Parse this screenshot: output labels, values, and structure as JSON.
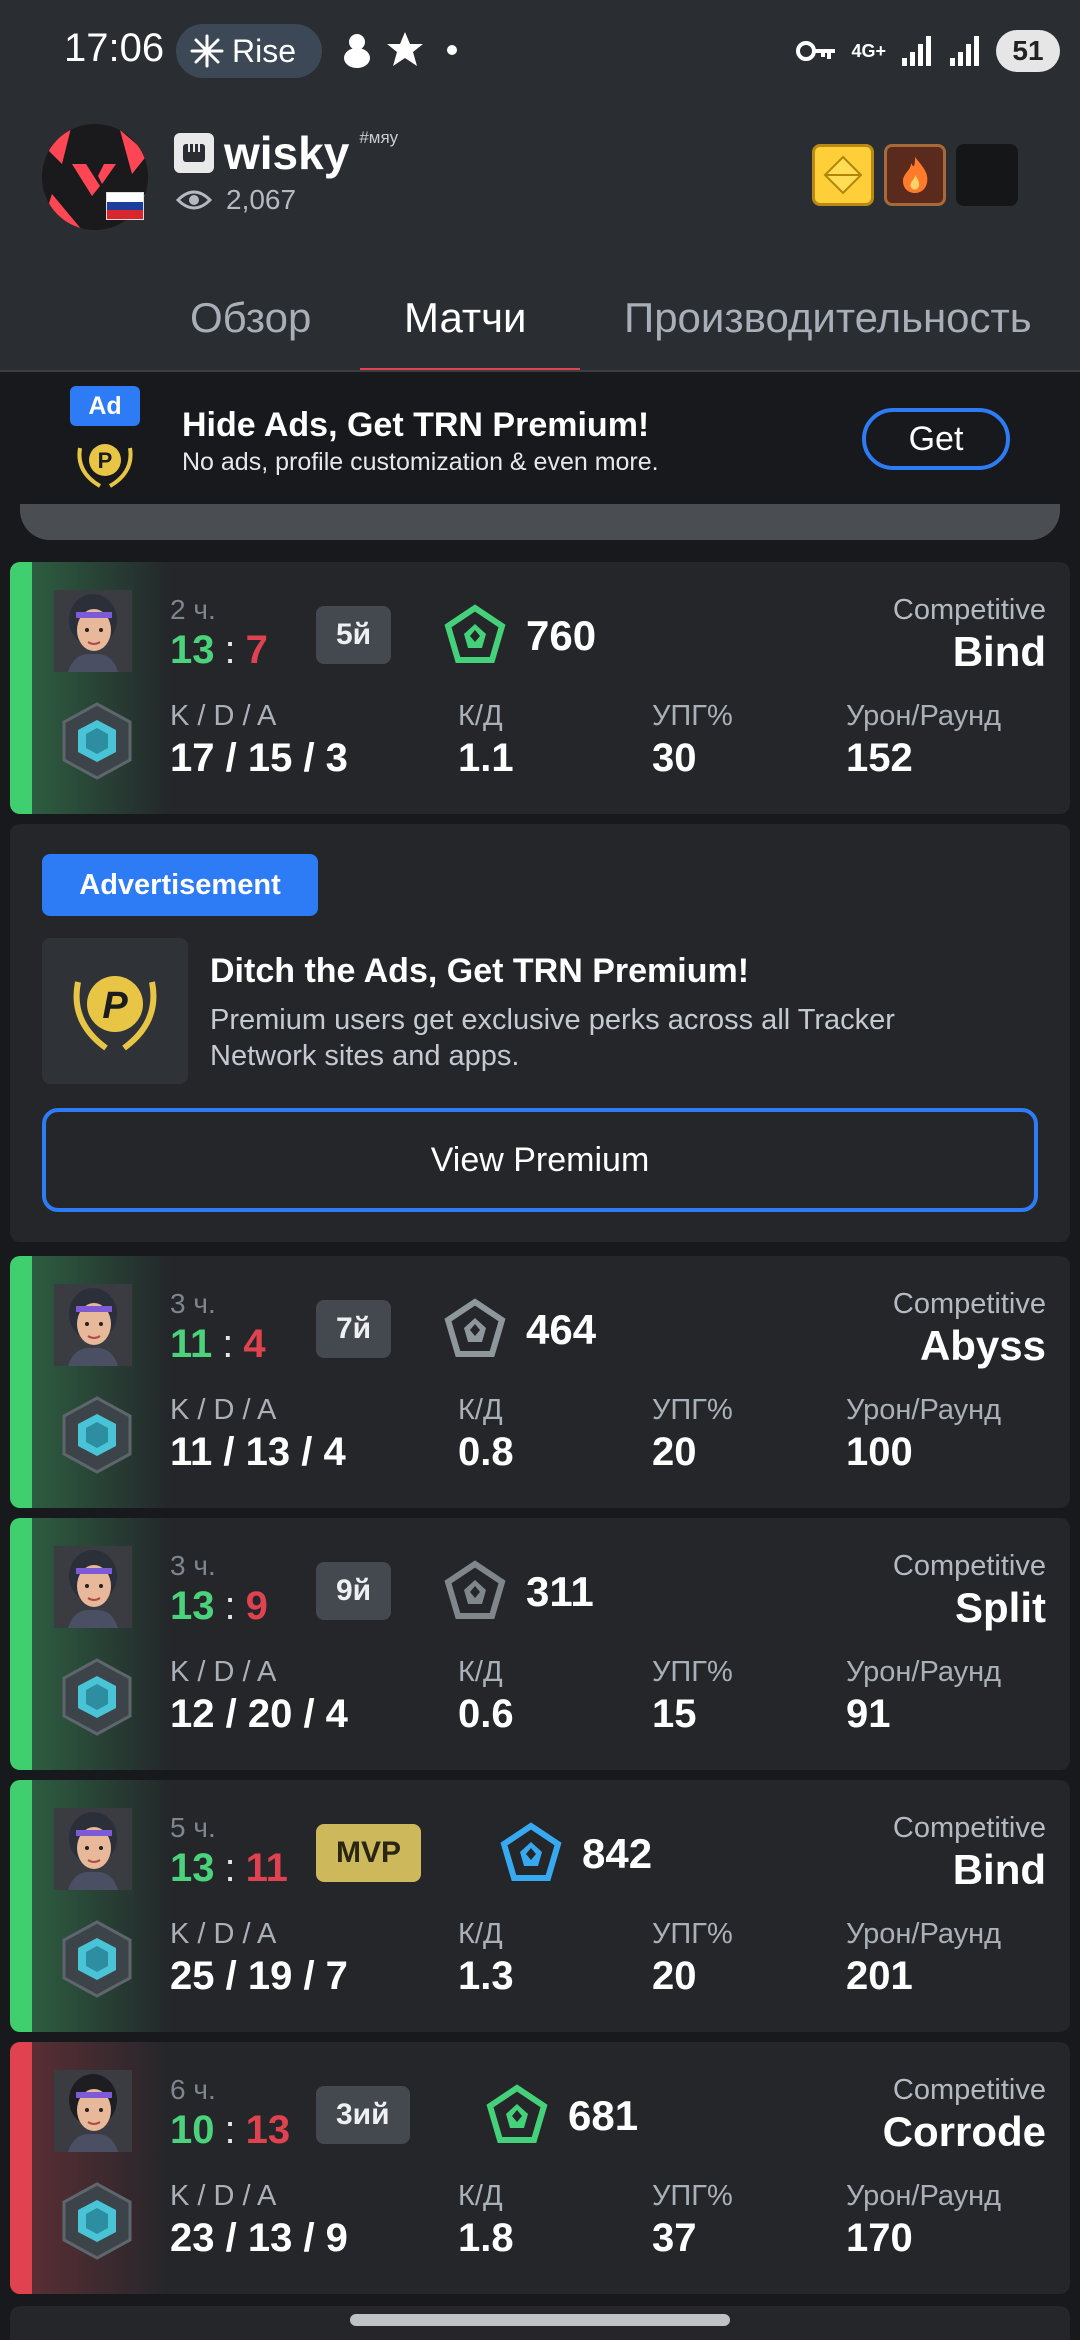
{
  "status_bar": {
    "time": "17:06",
    "pill_label": "Rise",
    "network": "4G+",
    "battery": "51"
  },
  "profile": {
    "name": "wisky",
    "tag": "#мяу",
    "views": "2,067"
  },
  "tabs": [
    {
      "label": "Обзор",
      "active": false
    },
    {
      "label": "Матчи",
      "active": true
    },
    {
      "label": "Производительность",
      "active": false
    }
  ],
  "ad_banner": {
    "tag": "Ad",
    "title": "Hide Ads, Get TRN Premium!",
    "subtitle": "No ads, profile customization & even more.",
    "button": "Get"
  },
  "labels": {
    "kda": "K / D / A",
    "kd": "К/Д",
    "hs": "УПГ%",
    "adr": "Урон/Раунд"
  },
  "matches": [
    {
      "time": "2 ч.",
      "score_a": "13",
      "score_sep": ":",
      "score_b": "7",
      "place": "5й",
      "rr": "760",
      "mode": "Competitive",
      "map": "Bind",
      "kda": "17 / 15 / 3",
      "kd": "1.1",
      "hs": "30",
      "adr": "152",
      "result": "win",
      "rank_color": "#45d07a"
    },
    {
      "time": "3 ч.",
      "score_a": "11",
      "score_sep": ":",
      "score_b": "4",
      "place": "7й",
      "rr": "464",
      "mode": "Competitive",
      "map": "Abyss",
      "kda": "11 / 13 / 4",
      "kd": "0.8",
      "hs": "20",
      "adr": "100",
      "result": "win",
      "rank_color": "#8d979c"
    },
    {
      "time": "3 ч.",
      "score_a": "13",
      "score_sep": ":",
      "score_b": "9",
      "place": "9й",
      "rr": "311",
      "mode": "Competitive",
      "map": "Split",
      "kda": "12 / 20 / 4",
      "kd": "0.6",
      "hs": "15",
      "adr": "91",
      "result": "win",
      "rank_color": "#7f878c"
    },
    {
      "time": "5 ч.",
      "score_a": "13",
      "score_sep": ":",
      "score_b": "11",
      "place": "MVP",
      "rr": "842",
      "mode": "Competitive",
      "map": "Bind",
      "kda": "25 / 19 / 7",
      "kd": "1.3",
      "hs": "20",
      "adr": "201",
      "result": "win",
      "rank_color": "#36a9f0"
    },
    {
      "time": "6 ч.",
      "score_a": "10",
      "score_sep": ":",
      "score_b": "13",
      "place": "3ий",
      "rr": "681",
      "mode": "Competitive",
      "map": "Corrode",
      "kda": "23 / 13 / 9",
      "kd": "1.8",
      "hs": "37",
      "adr": "170",
      "result": "loss",
      "rank_color": "#45d07a"
    }
  ],
  "advertisement": {
    "tag": "Advertisement",
    "title": "Ditch the Ads, Get TRN Premium!",
    "description": "Premium users get exclusive perks across all Tracker Network sites and apps.",
    "button": "View Premium"
  },
  "colors": {
    "win": "#3fcf6f",
    "loss": "#e0434f",
    "accent_blue": "#2e7bf6"
  }
}
